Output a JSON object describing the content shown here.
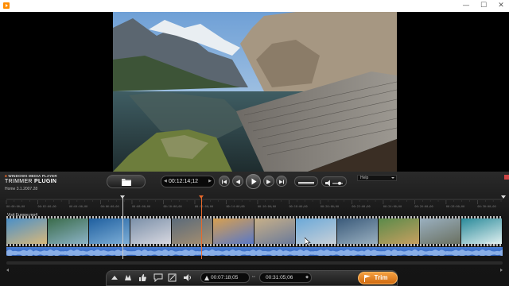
{
  "titlebar": {
    "minimize": "—",
    "maximize": "☐",
    "close": "✕"
  },
  "brand": {
    "small": "WINDOWS MEDIA PLAYER",
    "product_plain": "TRIMMER ",
    "product_bold": "PLUGIN",
    "edition": "Home 3.1.2007.28"
  },
  "transport": {
    "current_time": "00:12:14;12"
  },
  "help": {
    "label": "Help"
  },
  "timeline": {
    "ticks": [
      "00:00:00;00",
      "00:02:00;00",
      "00:04:00;00",
      "00:06:00;00",
      "00:08:00;00",
      "00:10:00;00",
      "00:12:00;00",
      "00:14:00;00",
      "00:16:00;00",
      "00:18:00;00",
      "00:20:00;00",
      "00:22:00;00",
      "00:24:00;00",
      "00:26:00;00",
      "00:28:00;00",
      "00:30:00;00"
    ],
    "clip_title": "Visit Europe.mp4",
    "clip_duration": "31:05",
    "thumb_colors": [
      [
        "#4a8fc8",
        "#d8b87a"
      ],
      [
        "#3a6b4a",
        "#8db4c8"
      ],
      [
        "#1f5f9f",
        "#7fb0d8"
      ],
      [
        "#7a8fa8",
        "#d8d8e0"
      ],
      [
        "#5a6a7a",
        "#a89070"
      ],
      [
        "#d8a050",
        "#5878c8"
      ],
      [
        "#c8b088",
        "#6a7a9a"
      ],
      [
        "#6aa8d8",
        "#c8d0d8"
      ],
      [
        "#3a5a7a",
        "#9ab0c0"
      ],
      [
        "#5a8a4a",
        "#c8a060"
      ],
      [
        "#9ab0c0",
        "#6a7060"
      ],
      [
        "#2a8a9a",
        "#e0f0f0"
      ]
    ]
  },
  "bottom": {
    "start_time": "00:07:18;05",
    "end_time": "00:31:05;06",
    "trim_label": "Trim"
  },
  "colors": {
    "accent": "#e8692b",
    "audio": "#3f72cf"
  }
}
